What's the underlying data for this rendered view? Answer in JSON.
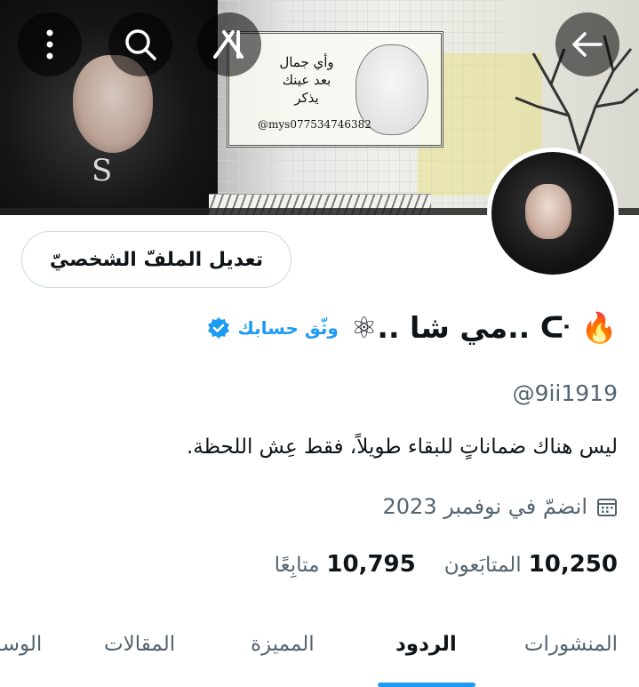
{
  "banner": {
    "card_text_line1": "وأي جمال",
    "card_text_line2": "بعد عينك",
    "card_text_line3": "يذكر",
    "card_handle": "@mys077534746382",
    "letter": "S"
  },
  "toolbar": {
    "back_icon": "arrow-left-icon",
    "grok_icon": "grok-logo-icon",
    "search_icon": "search-icon",
    "more_icon": "more-vertical-icon"
  },
  "profile": {
    "edit_label": "تعديل الملفّ الشخصيّ",
    "display_name": "⚛.. مي شا.. ᑢ 🔥",
    "verify_label": "وثّق حسابك",
    "handle": "@9ii1919",
    "bio": "ليس هناك ضماناتٍ للبقاء طويلاً، فقط عِش اللحظة.",
    "joined": "انضمّ في نوفمبر 2023"
  },
  "stats": {
    "followers_count": "10,250",
    "followers_label": "المتابَعون",
    "following_count": "10,795",
    "following_label": "متابِعًا"
  },
  "tabs": {
    "posts": "المنشورات",
    "replies": "الردود",
    "highlights": "المميزة",
    "articles": "المقالات",
    "media": "الوسـ"
  },
  "colors": {
    "accent": "#1d9bf0",
    "secondary_text": "#536471",
    "primary_text": "#0f1419"
  }
}
